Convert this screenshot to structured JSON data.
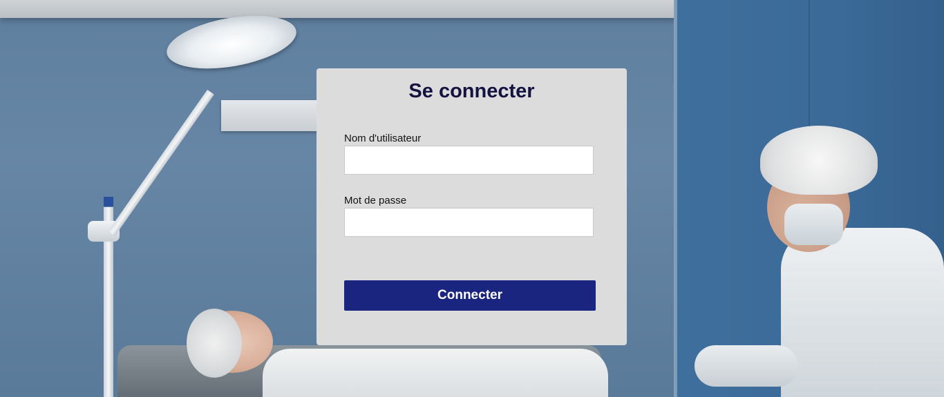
{
  "login": {
    "title": "Se connecter",
    "username_label": "Nom d'utilisateur",
    "username_value": "",
    "password_label": "Mot de passe",
    "password_value": "",
    "submit_label": "Connecter"
  },
  "colors": {
    "card_background": "#dcdcdc",
    "title_color": "#14123f",
    "button_color": "#1a2580",
    "button_text": "#ffffff"
  }
}
